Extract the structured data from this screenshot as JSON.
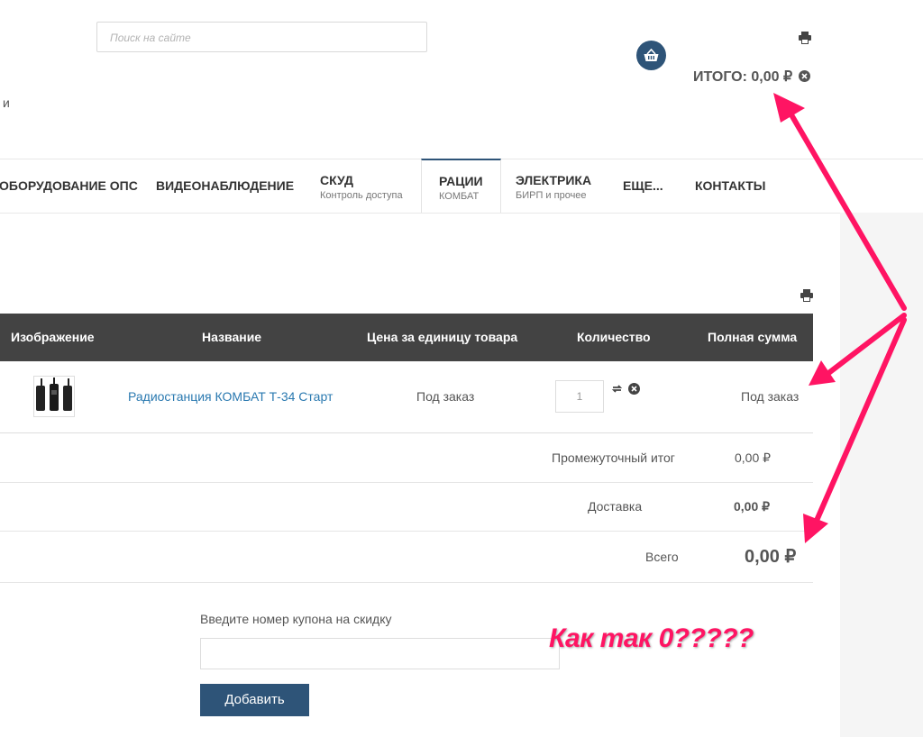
{
  "header": {
    "search_placeholder": "Поиск на сайте",
    "cart_total": "ИТОГО: 0,00 ₽",
    "stray_char": "и"
  },
  "nav": [
    {
      "title": "ОБОРУДОВАНИЕ ОПС",
      "subtitle": ""
    },
    {
      "title": "ВИДЕОНАБЛЮДЕНИЕ",
      "subtitle": ""
    },
    {
      "title": "СКУД",
      "subtitle": "Контроль доступа"
    },
    {
      "title": "РАЦИИ",
      "subtitle": "КОМБАТ",
      "active": true
    },
    {
      "title": "ЭЛЕКТРИКА",
      "subtitle": "БИРП и прочее"
    },
    {
      "title": "ЕЩЕ...",
      "subtitle": ""
    },
    {
      "title": "КОНТАКТЫ",
      "subtitle": ""
    }
  ],
  "cart": {
    "columns": [
      "Изображение",
      "Название",
      "Цена за единицу товара",
      "Количество",
      "Полная сумма"
    ],
    "items": [
      {
        "name": "Радиостанция КОМБАТ Т-34 Старт",
        "price": "Под заказ",
        "quantity": "1",
        "total": "Под заказ"
      }
    ],
    "subtotal_label": "Промежуточный итог",
    "subtotal_value": "0,00 ₽",
    "shipping_label": "Доставка",
    "shipping_value": "0,00 ₽",
    "total_label": "Всего",
    "total_value": "0,00 ₽"
  },
  "coupon": {
    "label": "Введите номер купона на скидку",
    "value": "",
    "button": "Добавить"
  },
  "annotation": {
    "text": "Как так 0?????",
    "color": "#ff1463"
  },
  "colors": {
    "accent": "#2e5478",
    "table_header": "#434343",
    "link": "#2a79b0"
  }
}
